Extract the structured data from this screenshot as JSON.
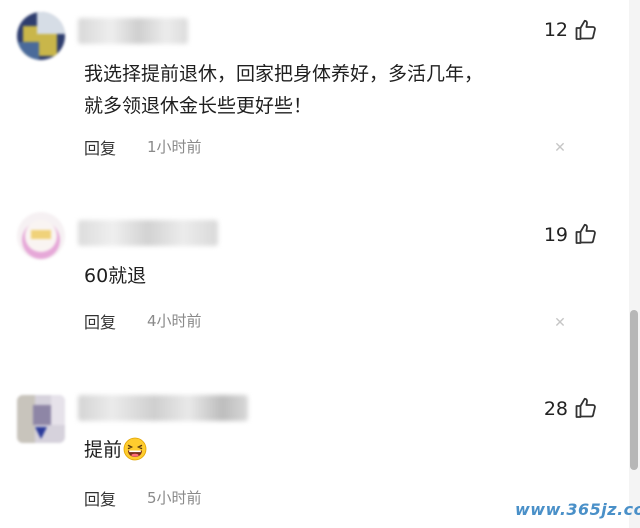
{
  "comments": [
    {
      "likes": "12",
      "text": "我选择提前退休，回家把身体养好，多活几年，就多领退休金长些更好些！",
      "reply_label": "回复",
      "time": "1小时前"
    },
    {
      "likes": "19",
      "text": "60就退",
      "reply_label": "回复",
      "time": "4小时前"
    },
    {
      "likes": "28",
      "text": "提前",
      "reply_label": "回复",
      "time": "5小时前"
    }
  ],
  "icons": {
    "like": "thumbs-up-icon",
    "close": "close-icon",
    "emoji": "laughing-emoji-icon"
  },
  "colors": {
    "text": "#1f1f1f",
    "time": "#8a8a8a",
    "watermark": "#4a90c8"
  },
  "watermark": "www.365jz.com"
}
